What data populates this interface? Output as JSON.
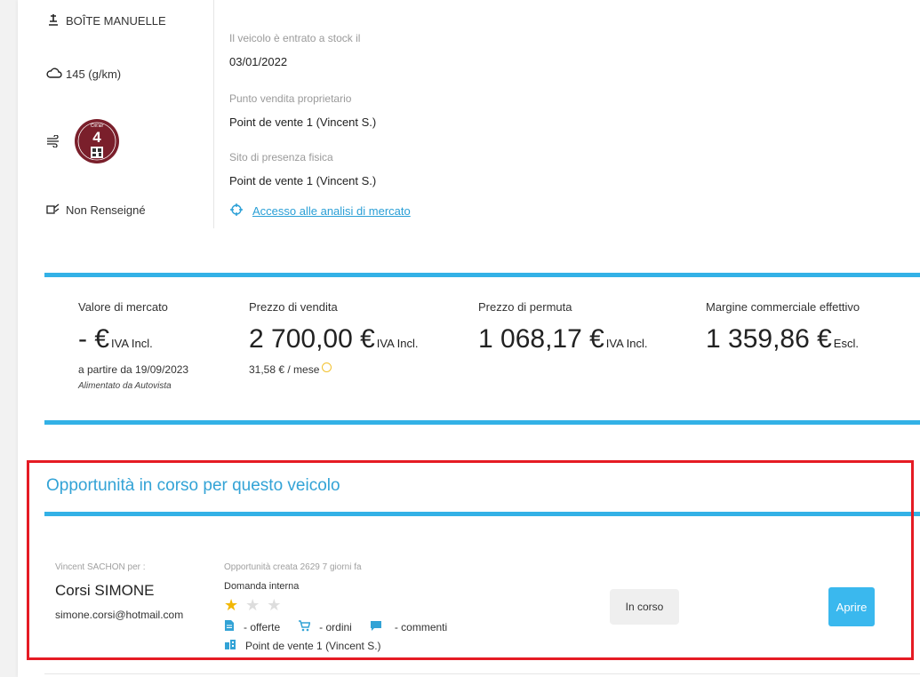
{
  "features": {
    "gearbox": "BOÎTE MANUELLE",
    "co2": "145 (g/km)",
    "critair_number": "4",
    "critair_top": "Crit'air",
    "consumption": "Non Renseigné"
  },
  "info": {
    "stock_label": "Il veicolo è entrato a stock il",
    "stock_value": "03/01/2022",
    "owner_label": "Punto vendita proprietario",
    "owner_value": "Point de vente 1 (Vincent S.)",
    "site_label": "Sito di presenza fisica",
    "site_value": "Point de vente 1 (Vincent S.)",
    "market_link": "Accesso alle analisi di mercato"
  },
  "prices": {
    "market_value_title": "Valore di mercato",
    "market_value": "- €",
    "market_value_suffix": "IVA Incl.",
    "market_value_from": "a partire da 19/09/2023",
    "market_value_source": "Alimentato da Autovista",
    "sale_price_title": "Prezzo di vendita",
    "sale_price": "2 700,00 €",
    "sale_price_suffix": "IVA Incl.",
    "monthly": "31,58 € / mese",
    "tradein_title": "Prezzo di permuta",
    "tradein_price": "1 068,17 €",
    "tradein_suffix": "IVA Incl.",
    "margin_title": "Margine commerciale effettivo",
    "margin_value": "1 359,86 €",
    "margin_suffix": "Escl."
  },
  "opportunity": {
    "section_title": "Opportunità in corso per questo veicolo",
    "seller": "Vincent SACHON per :",
    "customer_name": "Corsi SIMONE",
    "customer_email": "simone.corsi@hotmail.com",
    "created": "Opportunità creata 2629 7 giorni fa",
    "request_type": "Domanda interna",
    "rating": 1,
    "offers": "- offerte",
    "orders": "- ordini",
    "comments": "- commenti",
    "point_of_sale": "Point de vente 1 (Vincent S.)",
    "status": "In corso",
    "open_button": "Aprire"
  },
  "colors": {
    "accent": "#33b1e6",
    "highlight_border": "#e51b24",
    "open_button": "#3ab8ee",
    "critair": "#7a1f2b",
    "star_on": "#f2b705",
    "star_off": "#dddddd"
  }
}
